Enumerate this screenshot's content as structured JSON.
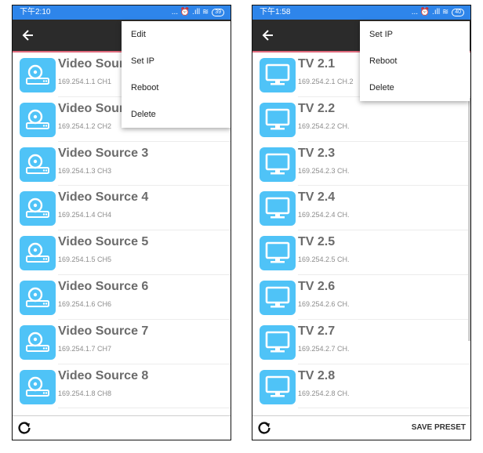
{
  "left": {
    "status_time": "下午2:10",
    "status_icons": "... ⏰ .ıll ≋",
    "battery": "39",
    "menu": [
      "Edit",
      "Set IP",
      "Reboot",
      "Delete"
    ],
    "items": [
      {
        "title": "Video Source 1",
        "sub": "169.254.1.1  CH1"
      },
      {
        "title": "Video Source 2",
        "sub": "169.254.1.2  CH2"
      },
      {
        "title": "Video Source 3",
        "sub": "169.254.1.3  CH3"
      },
      {
        "title": "Video Source 4",
        "sub": "169.254.1.4  CH4"
      },
      {
        "title": "Video Source 5",
        "sub": "169.254.1.5  CH5"
      },
      {
        "title": "Video Source 6",
        "sub": "169.254.1.6  CH6"
      },
      {
        "title": "Video Source 7",
        "sub": "169.254.1.7  CH7"
      },
      {
        "title": "Video Source 8",
        "sub": "169.254.1.8  CH8"
      }
    ]
  },
  "right": {
    "status_time": "下午1:58",
    "status_icons": "... ⏰ .ıll ≋",
    "battery": "40",
    "menu": [
      "Set IP",
      "Reboot",
      "Delete"
    ],
    "items": [
      {
        "title": "TV 2.1",
        "sub": "169.254.2.1  CH.2"
      },
      {
        "title": "TV 2.2",
        "sub": "169.254.2.2  CH."
      },
      {
        "title": "TV 2.3",
        "sub": "169.254.2.3  CH."
      },
      {
        "title": "TV 2.4",
        "sub": "169.254.2.4  CH."
      },
      {
        "title": "TV 2.5",
        "sub": "169.254.2.5  CH."
      },
      {
        "title": "TV 2.6",
        "sub": "169.254.2.6  CH."
      },
      {
        "title": "TV 2.7",
        "sub": "169.254.2.7  CH."
      },
      {
        "title": "TV 2.8",
        "sub": "169.254.2.8  CH."
      }
    ],
    "save_preset": "SAVE PRESET"
  },
  "colors": {
    "status_bar": "#2e85ea",
    "app_bar": "#2b2b2b",
    "accent_line": "#e06b7d",
    "icon_tile": "#4fc3f7"
  },
  "icons": {
    "source": "video-player-icon",
    "tv": "monitor-icon",
    "back": "back-arrow-icon",
    "refresh": "refresh-icon"
  }
}
